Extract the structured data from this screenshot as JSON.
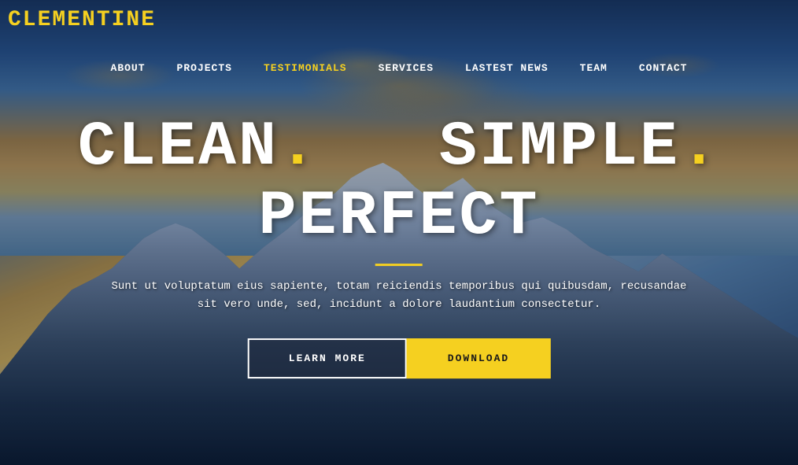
{
  "brand": {
    "logo": "CLEMENTINE"
  },
  "nav": {
    "items": [
      {
        "label": "ABOUT",
        "active": false
      },
      {
        "label": "PROJECTS",
        "active": false
      },
      {
        "label": "TESTIMONIALS",
        "active": true
      },
      {
        "label": "SERVICES",
        "active": false
      },
      {
        "label": "LASTEST NEWS",
        "active": false
      },
      {
        "label": "TEAM",
        "active": false
      },
      {
        "label": "CONTACT",
        "active": false
      }
    ]
  },
  "hero": {
    "tagline": "CLEAN. SIMPLE. PERFECT",
    "tagline_part1": "CLEAN",
    "tagline_dot1": ".",
    "tagline_part2": "SIMPLE",
    "tagline_dot2": ".",
    "tagline_part3": "PERFECT",
    "description": "Sunt ut voluptatum eius sapiente, totam reiciendis temporibus qui quibusdam, recusandae sit vero unde, sed, incidunt a dolore laudantium consectetur.",
    "btn_learn_more": "LEARN MORE",
    "btn_download": "DOWNLOAD"
  }
}
